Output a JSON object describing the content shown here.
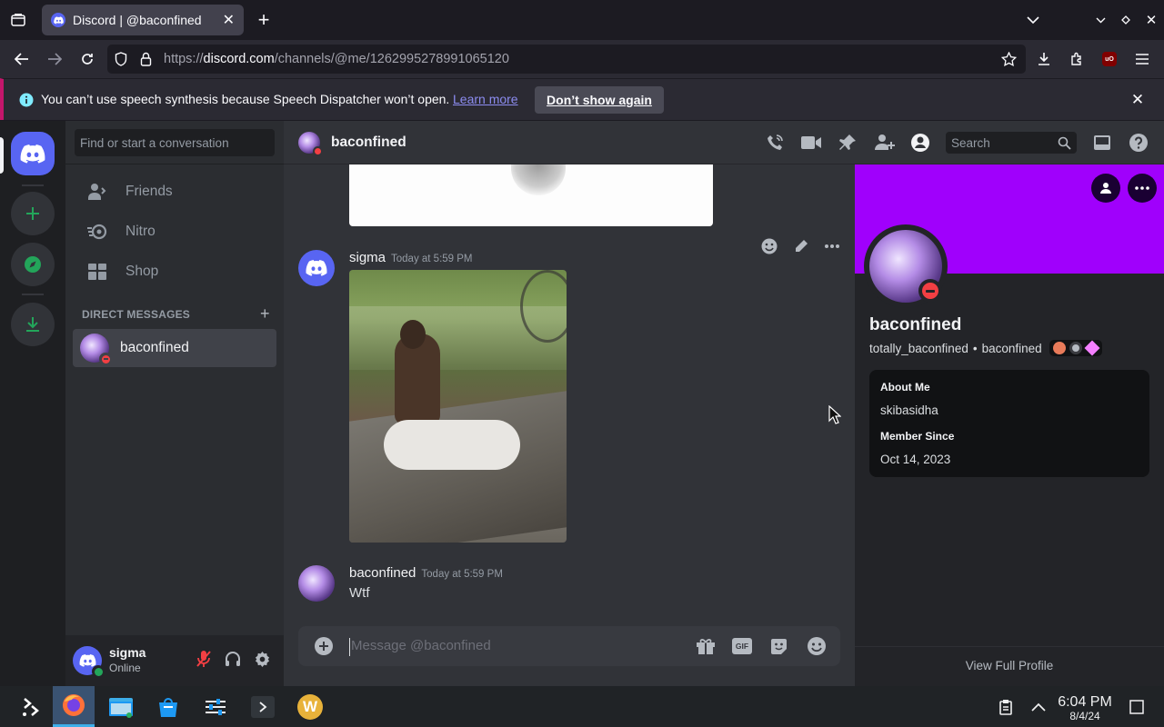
{
  "browser": {
    "tab_title": "Discord | @baconfined",
    "url_prefix": "https://",
    "url_domain": "discord.com",
    "url_path": "/channels/@me/1262995278991065120"
  },
  "infobar": {
    "message": "You can’t use speech synthesis because Speech Dispatcher won’t open.",
    "learn_more": "Learn more",
    "dont_show": "Don’t show again"
  },
  "sidebar": {
    "search_placeholder": "Find or start a conversation",
    "items": [
      {
        "label": "Friends"
      },
      {
        "label": "Nitro"
      },
      {
        "label": "Shop"
      }
    ],
    "dm_header": "DIRECT MESSAGES",
    "dms": [
      {
        "name": "baconfined"
      }
    ]
  },
  "user_panel": {
    "name": "sigma",
    "status": "Online"
  },
  "chat": {
    "channel_name": "baconfined",
    "search_placeholder": "Search",
    "messages": [
      {
        "author": "sigma",
        "time": "Today at 5:59 PM"
      },
      {
        "author": "baconfined",
        "time": "Today at 5:59 PM",
        "text": "Wtf"
      }
    ],
    "composer_placeholder": "Message @baconfined"
  },
  "profile": {
    "display_name": "baconfined",
    "username": "totally_baconfined",
    "separator": "•",
    "pronoun_name": "baconfined",
    "about_label": "About Me",
    "about_text": "skibasidha",
    "member_label": "Member Since",
    "member_date": "Oct 14, 2023",
    "view_full": "View Full Profile"
  },
  "taskbar": {
    "time": "6:04 PM",
    "date": "8/4/24"
  },
  "colors": {
    "accent": "#5865f2",
    "banner": "#a000fc",
    "online": "#23a55a",
    "dnd": "#f23f43"
  }
}
